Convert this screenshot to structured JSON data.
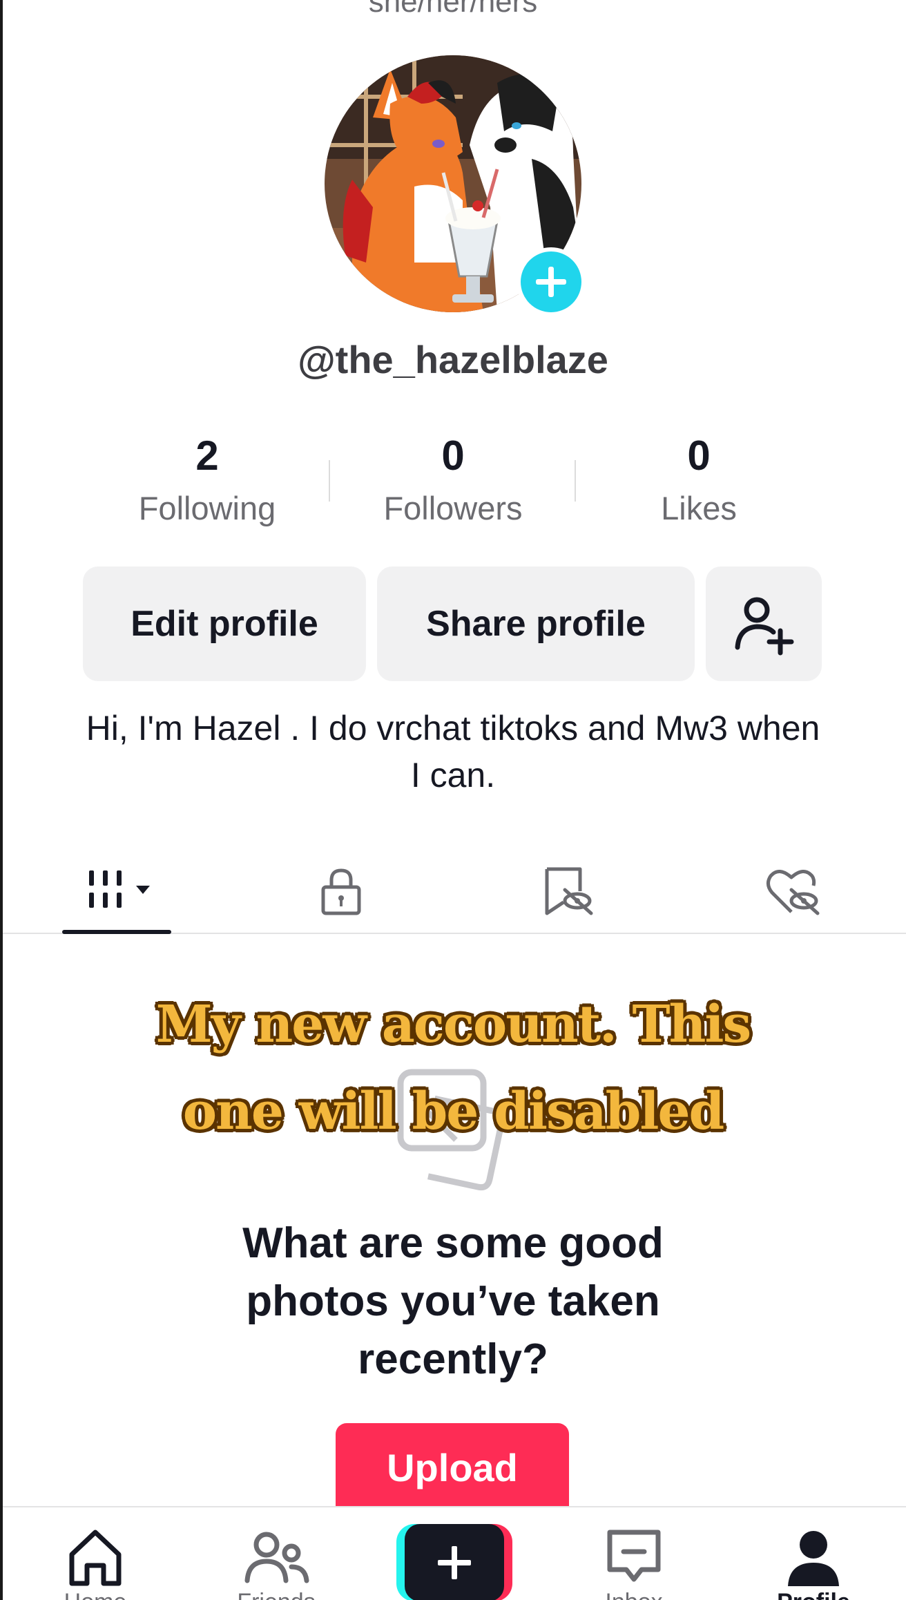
{
  "profile": {
    "pronouns": "she/her/hers",
    "username": "@the_hazelblaze",
    "bio": "Hi, I'm Hazel . I do vrchat tiktoks and Mw3 when I can."
  },
  "stats": {
    "following": {
      "value": "2",
      "label": "Following"
    },
    "followers": {
      "value": "0",
      "label": "Followers"
    },
    "likes": {
      "value": "0",
      "label": "Likes"
    }
  },
  "actions": {
    "edit_label": "Edit profile",
    "share_label": "Share profile",
    "add_friend_icon": "add-person-icon"
  },
  "tabs": [
    {
      "icon": "grid-icon",
      "active": true
    },
    {
      "icon": "lock-icon",
      "active": false
    },
    {
      "icon": "saved-icon",
      "active": false
    },
    {
      "icon": "liked-icon",
      "active": false
    }
  ],
  "overlay_text": "My new account. This one will be disabled",
  "empty_state": {
    "prompt": "What are some good photos you’ve taken recently?",
    "upload_label": "Upload"
  },
  "navbar": {
    "items": [
      {
        "label": "Home",
        "icon": "home-icon"
      },
      {
        "label": "Friends",
        "icon": "friends-icon"
      },
      {
        "label": "",
        "icon": "create-icon"
      },
      {
        "label": "Inbox",
        "icon": "inbox-icon"
      },
      {
        "label": "Profile",
        "icon": "profile-icon",
        "active": true
      }
    ]
  },
  "colors": {
    "accent_cyan": "#20d5ec",
    "upload_red": "#fe2c55",
    "overlay_gold": "#f3b73d"
  }
}
